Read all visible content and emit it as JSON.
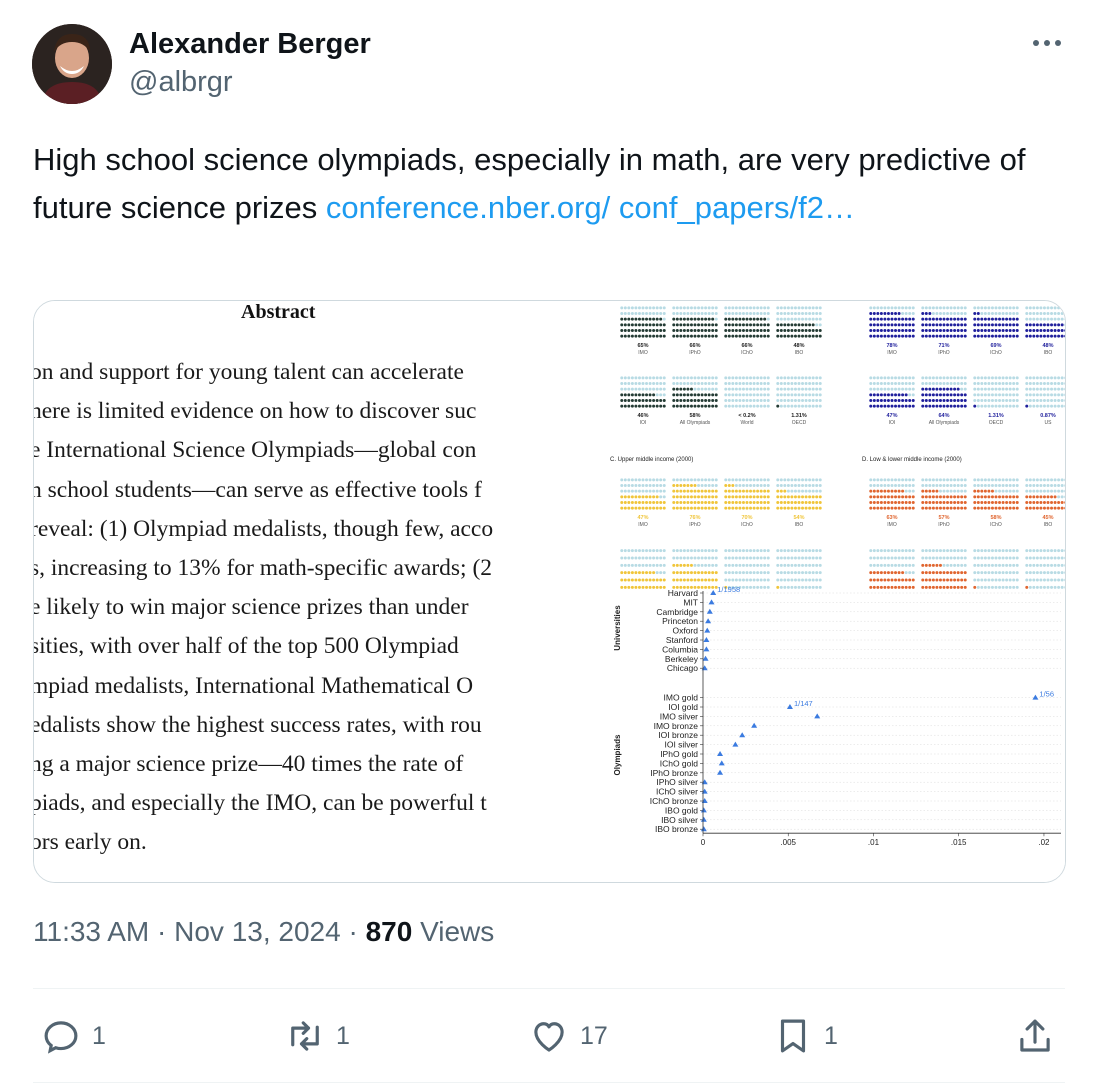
{
  "author": {
    "name": "Alexander Berger",
    "handle": "@albrgr"
  },
  "tweet": {
    "text": "High school science olympiads, especially in math, are very predictive of future science prizes ",
    "link_text": "conference.nber.org/ conf_papers/f2…"
  },
  "abstract": {
    "title": "Abstract",
    "lines": [
      "on and support for young talent can accelerate",
      "here is limited evidence on how to discover suc",
      "e International Science Olympiads—global con",
      "h school students—can serve as effective tools f",
      "reveal: (1) Olympiad medalists, though few, acco",
      "s, increasing to 13% for math-specific awards; (2",
      "e likely to win major science prizes than under",
      "sities, with over half of the top 500 Olympiad",
      "mpiad medalists, International Mathematical O",
      "edalists show the highest success rates, with rou",
      "ng a major science prize—40 times the rate of",
      "piads, and especially the IMO, can be powerful t",
      "ors early on."
    ]
  },
  "figure": {
    "panel_top_left": {
      "row1": [
        [
          "65%",
          "IMO"
        ],
        [
          "66%",
          "IPhO"
        ],
        [
          "66%",
          "IChO"
        ],
        [
          "48%",
          "IBO"
        ]
      ],
      "row2": [
        [
          "46%",
          "IOI"
        ],
        [
          "58%",
          "All Olympiads"
        ],
        [
          "< 0.2%",
          "World"
        ],
        [
          "1.31%",
          "OECD"
        ]
      ]
    },
    "panel_top_right": {
      "row1": [
        [
          "78%",
          "IMO"
        ],
        [
          "71%",
          "IPhO"
        ],
        [
          "69%",
          "IChO"
        ],
        [
          "48%",
          "IBO"
        ]
      ],
      "row2": [
        [
          "47%",
          "IOI"
        ],
        [
          "64%",
          "All Olympiads"
        ],
        [
          "1.31%",
          "OECD"
        ],
        [
          "0.87%",
          "US"
        ]
      ]
    },
    "panel_c_title": "C. Upper middle income (2000)",
    "panel_d_title": "D. Low & lower middle income (2000)",
    "panel_c_row1": [
      [
        "47%",
        "IMO"
      ],
      [
        "76%",
        "IPhO"
      ],
      [
        "70%",
        "IChO"
      ],
      [
        "54%",
        "IBO"
      ]
    ],
    "panel_d_row1": [
      [
        "63%",
        "IMO"
      ],
      [
        "57%",
        "IPhO"
      ],
      [
        "58%",
        "IChO"
      ],
      [
        "45%",
        "IBO"
      ]
    ],
    "colors": {
      "dark": "#233b34",
      "navy": "#1f1f9c",
      "gold": "#f0c53a",
      "orange": "#e0652f",
      "empty": "#b8dbe4",
      "point": "#3b7be0"
    }
  },
  "chart_data": {
    "type": "scatter",
    "xlim": [
      0,
      0.021
    ],
    "xticks": [
      "0",
      ".005",
      ".01",
      ".015",
      ".02"
    ],
    "group_labels": [
      "Universities",
      "Olympiads"
    ],
    "categories": [
      "Harvard",
      "MIT",
      "Cambridge",
      "Princeton",
      "Oxford",
      "Stanford",
      "Columbia",
      "Berkeley",
      "Chicago",
      "IMO gold",
      "IOI gold",
      "IMO silver",
      "IMO bronze",
      "IOI bronze",
      "IOI silver",
      "IPhO gold",
      "IChO gold",
      "IPhO bronze",
      "IPhO silver",
      "IChO silver",
      "IChO bronze",
      "IBO gold",
      "IBO silver",
      "IBO bronze"
    ],
    "values": [
      0.0006,
      0.0005,
      0.0004,
      0.0003,
      0.00025,
      0.0002,
      0.0002,
      0.00015,
      0.0001,
      0.0195,
      0.0051,
      0.0067,
      0.003,
      0.0023,
      0.0019,
      0.001,
      0.0011,
      0.001,
      0.0001,
      0.0001,
      0.0001,
      5e-05,
      5e-05,
      5e-05
    ],
    "annotations": [
      {
        "category": "Harvard",
        "text": "1/1958"
      },
      {
        "category": "IMO gold",
        "text": "1/56"
      },
      {
        "category": "IOI gold",
        "text": "1/147"
      }
    ]
  },
  "meta": {
    "time": "11:33 AM",
    "sep": "·",
    "date": "Nov 13, 2024",
    "views_count": "870",
    "views_label": "Views"
  },
  "actions": {
    "replies": "1",
    "retweets": "1",
    "likes": "17",
    "bookmarks": "1"
  },
  "icons": [
    "avatar",
    "more-icon",
    "reply-icon",
    "retweet-icon",
    "like-icon",
    "bookmark-icon",
    "share-icon"
  ]
}
